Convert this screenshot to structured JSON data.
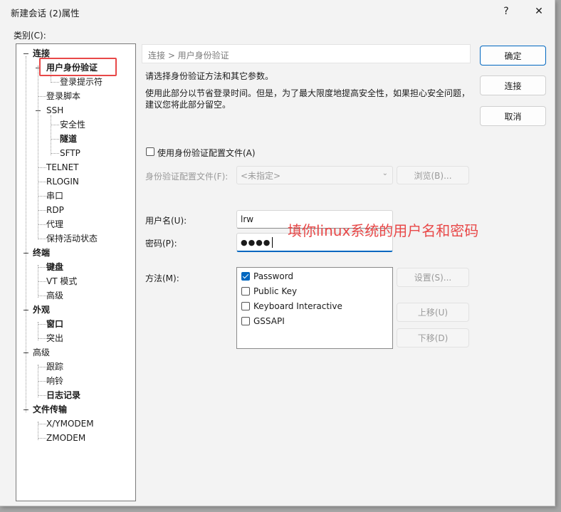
{
  "window": {
    "title": "新建会话 (2)属性",
    "help_glyph": "?",
    "close_glyph": "✕"
  },
  "category_label": "类别(C):",
  "tree": {
    "items": [
      {
        "label": "连接",
        "bold": true
      },
      {
        "label": "用户身份验证",
        "bold": true
      },
      {
        "label": "登录提示符",
        "bold": false
      },
      {
        "label": "登录脚本",
        "bold": false
      },
      {
        "label": "SSH",
        "bold": false
      },
      {
        "label": "安全性",
        "bold": false
      },
      {
        "label": "隧道",
        "bold": true
      },
      {
        "label": "SFTP",
        "bold": false
      },
      {
        "label": "TELNET",
        "bold": false
      },
      {
        "label": "RLOGIN",
        "bold": false
      },
      {
        "label": "串口",
        "bold": false
      },
      {
        "label": "RDP",
        "bold": false
      },
      {
        "label": "代理",
        "bold": false
      },
      {
        "label": "保持活动状态",
        "bold": false
      },
      {
        "label": "终端",
        "bold": true
      },
      {
        "label": "键盘",
        "bold": true
      },
      {
        "label": "VT 模式",
        "bold": false
      },
      {
        "label": "高级",
        "bold": false
      },
      {
        "label": "外观",
        "bold": true
      },
      {
        "label": "窗口",
        "bold": true
      },
      {
        "label": "突出",
        "bold": false
      },
      {
        "label": "高级",
        "bold": false
      },
      {
        "label": "跟踪",
        "bold": false
      },
      {
        "label": "响铃",
        "bold": false
      },
      {
        "label": "日志记录",
        "bold": true
      },
      {
        "label": "文件传输",
        "bold": true
      },
      {
        "label": "X/YMODEM",
        "bold": false
      },
      {
        "label": "ZMODEM",
        "bold": false
      }
    ]
  },
  "breadcrumb": "连接 > 用户身份验证",
  "description": {
    "line1": "请选择身份验证方法和其它参数。",
    "line2": "使用此部分以节省登录时间。但是，为了最大限度地提高安全性，如果担心安全问题，",
    "line3": "建议您将此部分留空。"
  },
  "buttons": {
    "ok": "确定",
    "connect": "连接",
    "cancel": "取消",
    "browse": "浏览(B)...",
    "settings": "设置(S)...",
    "move_up": "上移(U)",
    "move_down": "下移(D)"
  },
  "profile": {
    "checkbox_label": "使用身份验证配置文件(A)",
    "checked": false,
    "file_label": "身份验证配置文件(F):",
    "selected": "<未指定>"
  },
  "credentials": {
    "username_label": "用户名(U):",
    "username_value": "lrw",
    "password_label": "密码(P):",
    "password_value": "●●●●"
  },
  "methods": {
    "label": "方法(M):",
    "options": [
      {
        "label": "Password",
        "checked": true
      },
      {
        "label": "Public Key",
        "checked": false
      },
      {
        "label": "Keyboard Interactive",
        "checked": false
      },
      {
        "label": "GSSAPI",
        "checked": false
      }
    ]
  },
  "annotation": {
    "text": "填你linux系统的用户名和密码",
    "color": "#e84848"
  },
  "colors": {
    "accent": "#0067c0",
    "highlight": "#e84848"
  }
}
